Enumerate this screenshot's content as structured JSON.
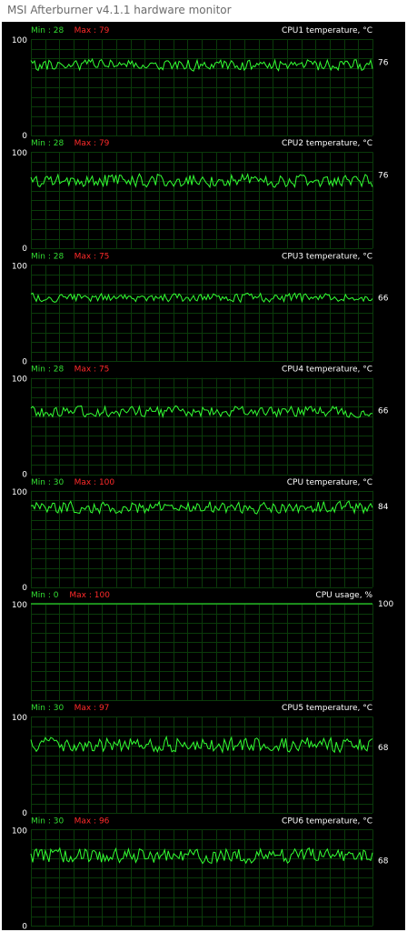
{
  "window": {
    "title": "MSI Afterburner v4.1.1 hardware monitor"
  },
  "colors": {
    "background": "#000000",
    "grid": "#0a3a0a",
    "trace": "#33ff33",
    "min_label": "#33dd33",
    "max_label": "#ff2a2a",
    "text": "#ffffff"
  },
  "graphs": [
    {
      "name": "CPU1 temperature, °C",
      "min_text": "Min : 28",
      "max_text": "Max : 79",
      "y_top": "100",
      "y_bottom": "0",
      "current": "76",
      "trace": {
        "base": 73,
        "amp": 4.2,
        "smooth": 0.35,
        "seed": 11
      }
    },
    {
      "name": "CPU2 temperature, °C",
      "min_text": "Min : 28",
      "max_text": "Max : 79",
      "y_top": "100",
      "y_bottom": "0",
      "current": "76",
      "trace": {
        "base": 71,
        "amp": 5.0,
        "smooth": 0.3,
        "seed": 23
      }
    },
    {
      "name": "CPU3 temperature, °C",
      "min_text": "Min : 28",
      "max_text": "Max : 75",
      "y_top": "100",
      "y_bottom": "0",
      "current": "66",
      "trace": {
        "base": 66,
        "amp": 3.2,
        "smooth": 0.35,
        "seed": 37
      }
    },
    {
      "name": "CPU4 temperature, °C",
      "min_text": "Min : 28",
      "max_text": "Max : 75",
      "y_top": "100",
      "y_bottom": "0",
      "current": "66",
      "trace": {
        "base": 65,
        "amp": 4.0,
        "smooth": 0.3,
        "seed": 41
      }
    },
    {
      "name": "CPU temperature, °C",
      "min_text": "Min : 30",
      "max_text": "Max : 100",
      "y_top": "100",
      "y_bottom": "0",
      "current": "84",
      "trace": {
        "base": 83,
        "amp": 4.5,
        "smooth": 0.3,
        "seed": 53
      }
    },
    {
      "name": "CPU usage, %",
      "min_text": "Min : 0",
      "max_text": "Max : 100",
      "y_top": "100",
      "y_bottom": "",
      "current": "100",
      "trace": {
        "base": 100,
        "amp": 0,
        "smooth": 1,
        "seed": 1
      }
    },
    {
      "name": "CPU5 temperature, °C",
      "min_text": "Min : 30",
      "max_text": "Max : 97",
      "y_top": "100",
      "y_bottom": "0",
      "current": "68",
      "trace": {
        "base": 71,
        "amp": 5.5,
        "smooth": 0.3,
        "seed": 67
      }
    },
    {
      "name": "CPU6 temperature, °C",
      "min_text": "Min : 30",
      "max_text": "Max : 96",
      "y_top": "100",
      "y_bottom": "0",
      "current": "68",
      "trace": {
        "base": 73,
        "amp": 5.5,
        "smooth": 0.3,
        "seed": 79
      }
    }
  ]
}
